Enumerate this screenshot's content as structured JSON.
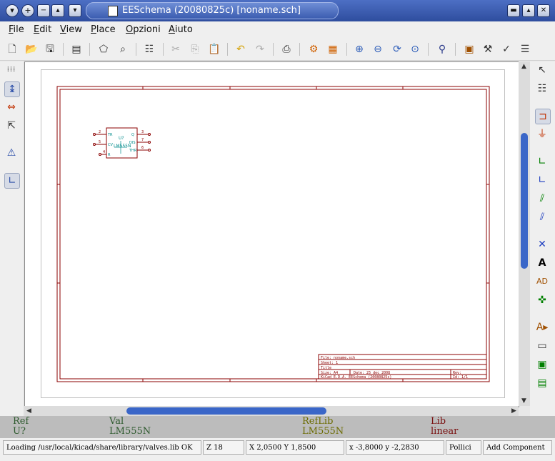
{
  "window": {
    "title": "EESchema (20080825c) [noname.sch]",
    "left_buttons": [
      "▾",
      "+",
      "−",
      "▴",
      "▾"
    ],
    "right_buttons": [
      "▬",
      "▴",
      "✕"
    ]
  },
  "menu": {
    "items": [
      {
        "label": "File",
        "accel": "F",
        "rest": "ile"
      },
      {
        "label": "Edit",
        "accel": "E",
        "rest": "dit"
      },
      {
        "label": "View",
        "accel": "V",
        "rest": "iew"
      },
      {
        "label": "Place",
        "accel": "P",
        "rest": "lace"
      },
      {
        "label": "Opzioni",
        "accel": "O",
        "rest": "pzioni"
      },
      {
        "label": "Aiuto",
        "accel": "A",
        "rest": "iuto"
      }
    ]
  },
  "colors": {
    "sheet_border": "#8b0000",
    "component_body": "#8b0000",
    "component_text": "#008b8b",
    "info_ref": "#2e5a2e",
    "info_reflib": "#6b6b00",
    "info_lib": "#7a1010",
    "accent": "#3a66c8"
  },
  "component": {
    "reference": "U?",
    "value": "LM555N",
    "pin_left": [
      "TR",
      "CV",
      "R"
    ],
    "pin_left_nums": [
      "2",
      "5",
      "4"
    ],
    "pin_right": [
      "Q",
      "DIS",
      "THR"
    ],
    "pin_right_nums": [
      "3",
      "7",
      "6"
    ]
  },
  "titleblock": {
    "file": "File: noname.sch",
    "sheet": "Sheet: 1",
    "title": "Title",
    "size": "Size: A4",
    "date": "Date: 25 dec 2008",
    "kicad": "KiCad E.D.A.   EESchema (20080825c)",
    "rev": "Rev:",
    "id": "Id: 1/1"
  },
  "info": {
    "ref_label": "Ref",
    "ref_value": "U?",
    "val_label": "Val",
    "val_value": "LM555N",
    "reflib_label": "RefLib",
    "reflib_value": "LM555N",
    "lib_label": "Lib",
    "lib_value": "linear"
  },
  "status": {
    "message": "Loading /usr/local/kicad/share/library/valves.lib OK",
    "zoom": "Z 18",
    "abs_coords": "X 2,0500  Y 1,8500",
    "rel_coords": "x -3,8000  y -2,2830",
    "units": "Pollici",
    "mode": "Add Component"
  }
}
